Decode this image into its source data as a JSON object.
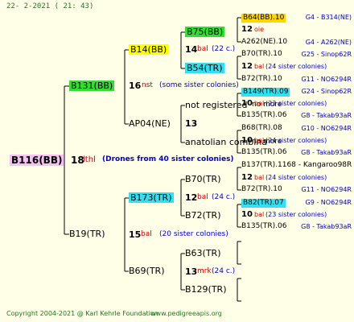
{
  "header": {
    "date": "22-  2-2021 (  21: 43)"
  },
  "footer": {
    "copyright": "Copyright 2004-2021 @ Karl Kehrle Foundation",
    "url": "www.pedigreeapis.org"
  },
  "root": {
    "name": "B116(BB)",
    "gen": "18",
    "mark": "lthl",
    "note": "(Drones from 40 sister colonies)"
  },
  "upper": {
    "name": "B131(BB)",
    "gen": "16",
    "mark": "nst",
    "note": "(some sister colonies)",
    "a": {
      "name": "B14(BB)",
      "gen": "14",
      "mark": "bal",
      "note": "(22 c.)",
      "a": {
        "name": "B75(BB)"
      },
      "b": {
        "name": "B54(TR)"
      }
    },
    "b": {
      "name": "AP04(NE)",
      "gen": "13",
      "a": {
        "name": "not registered",
        "right": "no more"
      },
      "b": {
        "name": "anatolian combina",
        "right": "no more"
      }
    }
  },
  "lower": {
    "name": "B19(TR)",
    "gen": "15",
    "mark": "bal",
    "note": "(20 sister colonies)",
    "a": {
      "name": "B173(TR)",
      "gen": "12",
      "mark": "bal",
      "note": "(24 c.)",
      "a": {
        "name": "B70(TR)"
      },
      "b": {
        "name": "B72(TR)"
      }
    },
    "b": {
      "name": "B69(TR)",
      "gen": "13",
      "mark": "mrk",
      "note": "(24 c.)",
      "a": {
        "name": "B63(TR)"
      },
      "b": {
        "name": "B129(TR)"
      }
    }
  },
  "rows": [
    {
      "name": "B64(BB).10",
      "ref": "G4 - B314(NE)",
      "gen": "",
      "mark": "",
      "note": ""
    },
    {
      "name": "",
      "ref": "",
      "gen": "12",
      "mark": "oie",
      "note": ""
    },
    {
      "name": "A262(NE).10",
      "ref": "G4 - A262(NE)",
      "gen": "",
      "mark": "",
      "note": ""
    },
    {
      "name": "B70(TR).10",
      "ref": "G25 - Sinop62R",
      "gen": "",
      "mark": "",
      "note": ""
    },
    {
      "name": "",
      "ref": "",
      "gen": "12",
      "mark": "bal",
      "note": "(24 sister colonies)"
    },
    {
      "name": "B72(TR).10",
      "ref": "G11 - NO6294R",
      "gen": "",
      "mark": "",
      "note": ""
    },
    {
      "name": "B149(TR).09",
      "ref": "G24 - Sinop62R",
      "gen": "",
      "mark": "",
      "note": ""
    },
    {
      "name": "",
      "ref": "",
      "gen": "10",
      "mark": "bal",
      "note": "(23 sister colonies)"
    },
    {
      "name": "B135(TR).06",
      "ref": "G8 - Takab93aR",
      "gen": "",
      "mark": "",
      "note": ""
    },
    {
      "name": "B68(TR).08",
      "ref": "G10 - NO6294R",
      "gen": "",
      "mark": "",
      "note": ""
    },
    {
      "name": "",
      "ref": "",
      "gen": "10",
      "mark": "bal",
      "note": "(24 sister colonies)"
    },
    {
      "name": "B135(TR).06",
      "ref": "G8 - Takab93aR",
      "gen": "",
      "mark": "",
      "note": ""
    },
    {
      "name": "B137(TR).1168 - Kangaroo98R",
      "ref": "",
      "gen": "",
      "mark": "",
      "note": ""
    },
    {
      "name": "",
      "ref": "",
      "gen": "12",
      "mark": "bal",
      "note": "(24 sister colonies)"
    },
    {
      "name": "B72(TR).10",
      "ref": "G11 - NO6294R",
      "gen": "",
      "mark": "",
      "note": ""
    },
    {
      "name": "B82(TR).07",
      "ref": "G9 - NO6294R",
      "gen": "",
      "mark": "",
      "note": ""
    },
    {
      "name": "",
      "ref": "",
      "gen": "10",
      "mark": "bal",
      "note": "(23 sister colonies)"
    },
    {
      "name": "B135(TR).06",
      "ref": "G8 - Takab93aR",
      "gen": "",
      "mark": "",
      "note": ""
    }
  ],
  "colors": {
    "pink": "#f4c2f0",
    "green": "#33dd33",
    "yellow": "#ffff00",
    "cyan": "#33e0f0",
    "gold": "#ffd700"
  }
}
